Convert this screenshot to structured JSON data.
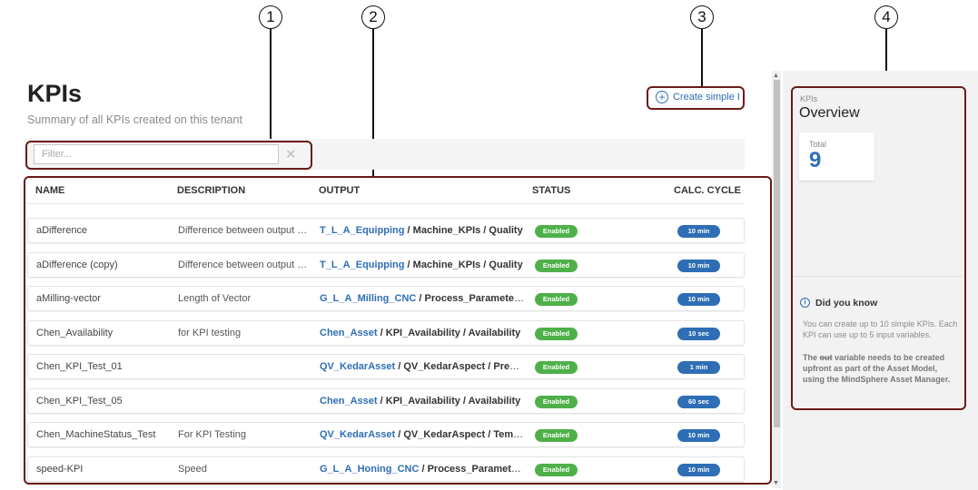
{
  "callouts": [
    "1",
    "2",
    "3",
    "4"
  ],
  "header": {
    "title": "KPIs",
    "subtitle": "Summary of all KPIs created on this tenant"
  },
  "filter": {
    "placeholder": "Filter...",
    "clear": "✕"
  },
  "create_button": {
    "label": "Create simple KPI",
    "icon": "plus-circle-icon"
  },
  "table": {
    "columns": [
      "NAME",
      "DESCRIPTION",
      "OUTPUT",
      "STATUS",
      "CALC. CYCLE"
    ],
    "rows": [
      {
        "name": "aDifference",
        "description": "Difference between output an...",
        "output_asset": "T_L_A_Equipping",
        "output_rest": " / Machine_KPIs / Quality",
        "status": "Enabled",
        "cycle": "10 min"
      },
      {
        "name": "aDifference (copy)",
        "description": "Difference between output an...",
        "output_asset": "T_L_A_Equipping",
        "output_rest": " / Machine_KPIs / Quality",
        "status": "Enabled",
        "cycle": "10 min"
      },
      {
        "name": "aMilling-vector",
        "description": "Length of Vector",
        "output_asset": "G_L_A_Milling_CNC",
        "output_rest": " / Process_Parameters / Sp...",
        "status": "Enabled",
        "cycle": "10 min"
      },
      {
        "name": "Chen_Availability",
        "description": "for KPI testing",
        "output_asset": "Chen_Asset",
        "output_rest": " / KPI_Availability / Availability",
        "status": "Enabled",
        "cycle": "10 sec"
      },
      {
        "name": "Chen_KPI_Test_01",
        "description": "",
        "output_asset": "QV_KedarAsset",
        "output_rest": " / QV_KedarAspect / Pressure",
        "status": "Enabled",
        "cycle": "1 min"
      },
      {
        "name": "Chen_KPI_Test_05",
        "description": "",
        "output_asset": "Chen_Asset",
        "output_rest": " / KPI_Availability / Availability",
        "status": "Enabled",
        "cycle": "60 sec"
      },
      {
        "name": "Chen_MachineStatus_Test",
        "description": "For KPI Testing",
        "output_asset": "QV_KedarAsset",
        "output_rest": " / QV_KedarAspect / Temperat...",
        "status": "Enabled",
        "cycle": "10 min"
      },
      {
        "name": "speed-KPI",
        "description": "Speed",
        "output_asset": "G_L_A_Honing_CNC",
        "output_rest": " / Process_Parameters / S...",
        "status": "Enabled",
        "cycle": "10 min"
      }
    ]
  },
  "overview": {
    "label": "KPIs",
    "title": "Overview",
    "total_label": "Total",
    "total_value": "9",
    "did_you_know": {
      "title": "Did you know",
      "icon": "info-icon",
      "p1": "You can create up to 10 simple KPIs. Each KPI can use up to 5 input variables.",
      "p2_a": "The ",
      "p2_strike": "out",
      "p2_b": " variable needs to be created upfront as part of the Asset Model, using the MindSphere Asset Manager."
    }
  },
  "colors": {
    "accent": "#2f6eb5",
    "enabled": "#4fb04a",
    "highlight": "#6b1a1a"
  }
}
